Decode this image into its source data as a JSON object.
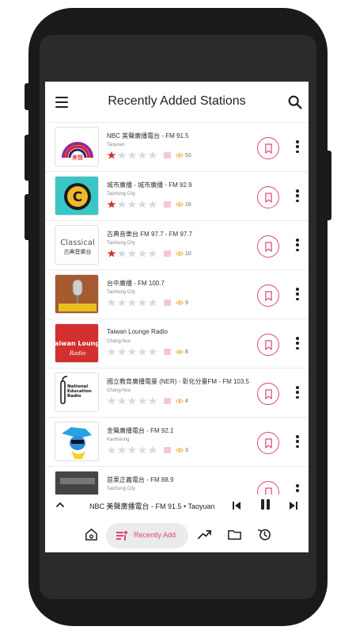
{
  "appbar": {
    "title": "Recently Added Stations"
  },
  "stations": [
    {
      "name": "NBC 美聲廣播電台 - FM 91.5",
      "city": "Taoyuan",
      "rating": 1,
      "views": "53",
      "logo_text": "美聲"
    },
    {
      "name": "城市廣播 - 城市廣播 - FM 92.9",
      "city": "Taichung City",
      "rating": 1,
      "views": "16",
      "logo_text": "C"
    },
    {
      "name": "古典音樂台 FM 97.7 - FM 97.7",
      "city": "Taichung City",
      "rating": 1,
      "views": "10",
      "logo_text": "Classical",
      "logo_subtext": "古典音樂台"
    },
    {
      "name": "台中廣播 - FM 100.7",
      "city": "Taichung City",
      "rating": 0,
      "views": "9",
      "logo_text": ""
    },
    {
      "name": "Taiwan Lounge Radio",
      "city": "Chang-hua",
      "rating": 0,
      "views": "8",
      "logo_text": "Taiwan Lounge",
      "logo_subtext": "Radio"
    },
    {
      "name": "國立教育廣播電臺 (NER) - 彰化分臺FM - FM 103.5",
      "city": "Chang-hua",
      "rating": 0,
      "views": "4",
      "logo_text": "National Education Radio"
    },
    {
      "name": "金聲廣播電台 - FM 92.1",
      "city": "Kaohsiung",
      "rating": 0,
      "views": "3",
      "logo_text": ""
    },
    {
      "name": "苗栗正義電台 - FM 88.9",
      "city": "Taichung City",
      "rating": 0,
      "views": "",
      "logo_text": ""
    }
  ],
  "player": {
    "now_playing": "NBC 美聲廣播電台 - FM 91.5 • Taoyuan"
  },
  "bottom_nav": {
    "active_label": "Recently Add"
  },
  "colors": {
    "accent": "#e0457b",
    "star_active": "#d32f2f",
    "star_inactive": "#d9d9d9"
  },
  "icons": [
    "menu-icon",
    "search-icon",
    "bookmark-icon",
    "more-vert-icon",
    "eye-icon",
    "chevron-up-icon",
    "skip-previous-icon",
    "pause-icon",
    "skip-next-icon",
    "home-icon",
    "recent-list-icon",
    "trending-icon",
    "folder-icon",
    "history-icon"
  ]
}
